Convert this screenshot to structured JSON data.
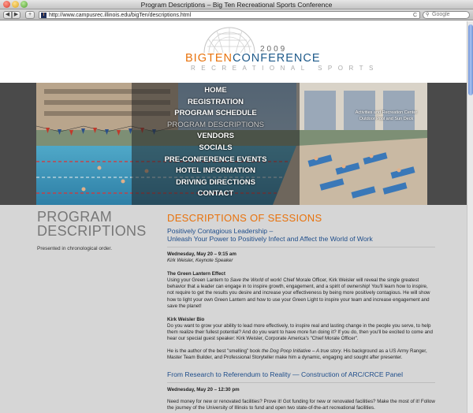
{
  "window": {
    "title": "Program Descriptions – Big Ten Recreational Sports Conference"
  },
  "toolbar": {
    "back": "◀",
    "forward": "▶",
    "add": "+",
    "url": "http://www.campusrec.illinois.edu/bigTen/descriptions.html",
    "favicon": "I",
    "reload": "C",
    "search_placeholder": "Google"
  },
  "header": {
    "year": "2009",
    "brand_part1": "BIGTEN",
    "brand_part2": "CONFERENCE",
    "tagline": "RECREATIONAL SPORTS",
    "brand_orange": "#e8720c",
    "brand_blue": "#1e5a8a"
  },
  "nav": [
    "HOME",
    "REGISTRATION",
    "PROGRAM SCHEDULE",
    "PROGRAM DESCRIPTIONS",
    "VENDORS",
    "SOCIALS",
    "PRE-CONFERENCE EVENTS",
    "HOTEL INFORMATION",
    "DRIVING DIRECTIONS",
    "CONTACT"
  ],
  "banner_caption": {
    "line1": "Activities and Recreation Center",
    "line2": "Outdoor Pool and Sun Deck"
  },
  "sidebar": {
    "title_line1": "PROGRAM",
    "title_line2": "DESCRIPTIONS",
    "note": "Presented in chronological order."
  },
  "main": {
    "heading": "DESCRIPTIONS OF SESSIONS",
    "sessions": [
      {
        "title_line1": "Positively Contagious Leadership –",
        "title_line2": "Unleash Your Power to Positively Infect and Affect the World of Work",
        "when": "Wednesday, May 20 – 9:15 am",
        "who": "Kirk Weisler, Keynote Speaker",
        "sub1": "The Green Lantern Effect",
        "p1_a": "Using your Green Lantern to ",
        "p1_em": "Save the World",
        "p1_b": " of work! Chief Morale Officer, Kirk Weisler will reveal the single greatest behavior that a leader can engage in to inspire growth, engagement, and a spirit of ownership! You'll learn how to inspire, not require to get the results you desire and increase your effectiveness by being more positively contagious. He will show how to light your own Green Lantern and how to use your Green Light to inspire your team and increase engagement and save the planet!",
        "sub2": "Kirk Weisler Bio",
        "p2": "Do you want to grow your ability to lead more effectively, to inspire real and lasting change in the people you serve, to help them realize their fullest potential? And do you want to have more fun doing it? If you do, then you'll be excited to come and hear our special guest speaker: Kirk Weisler, Corporate America's \"Chief Morale Officer\".",
        "p3_a": "He is the author of the best \"smelling\" book ",
        "p3_em": "the Dog Poop Initiative – A true story",
        "p3_b": ". His background as a US Army Ranger, Master Team Builder, and Professional Storyteller make him a dynamic, engaging and sought after presenter."
      },
      {
        "title": "From Research to Referendum to Reality — Construction of ARC/CRCE Panel",
        "when": "Wednesday, May 20 – 12:30 pm",
        "p1": "Need money for new or renovated facilities? Prove it! Got funding for new or renovated facilities? Make the most of it! Follow the journey of the University of Illinois to fund and open two state-of-the-art recreational facilities."
      }
    ]
  }
}
